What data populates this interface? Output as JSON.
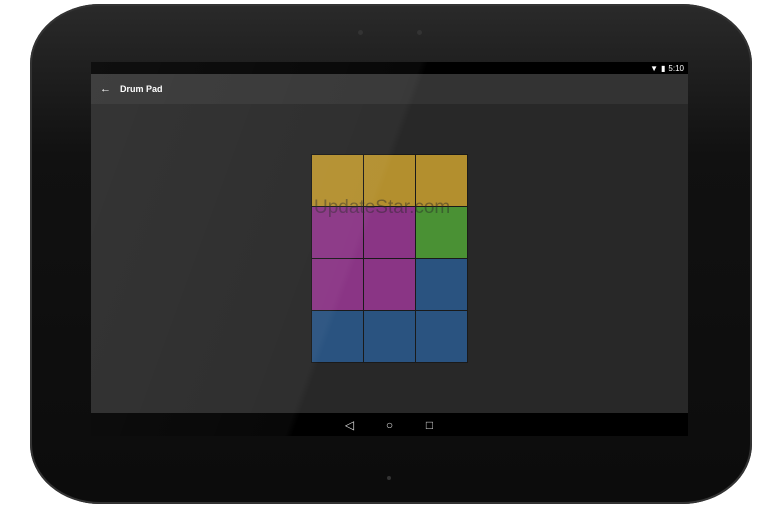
{
  "status_bar": {
    "time": "5:10",
    "icons": [
      "wifi-icon",
      "battery-icon"
    ]
  },
  "app_bar": {
    "title": "Drum Pad",
    "back_icon": "arrow-left-icon"
  },
  "pads": [
    {
      "color": "#b38f2e"
    },
    {
      "color": "#b38f2e"
    },
    {
      "color": "#b38f2e"
    },
    {
      "color": "#8a3585"
    },
    {
      "color": "#8a3585"
    },
    {
      "color": "#4a9134"
    },
    {
      "color": "#8a3585"
    },
    {
      "color": "#8a3585"
    },
    {
      "color": "#2a5380"
    },
    {
      "color": "#2a5380"
    },
    {
      "color": "#2a5380"
    },
    {
      "color": "#2a5380"
    }
  ],
  "watermark": "UpdateStar.com",
  "nav_bar": {
    "back": "◁",
    "home": "○",
    "recents": "□"
  }
}
